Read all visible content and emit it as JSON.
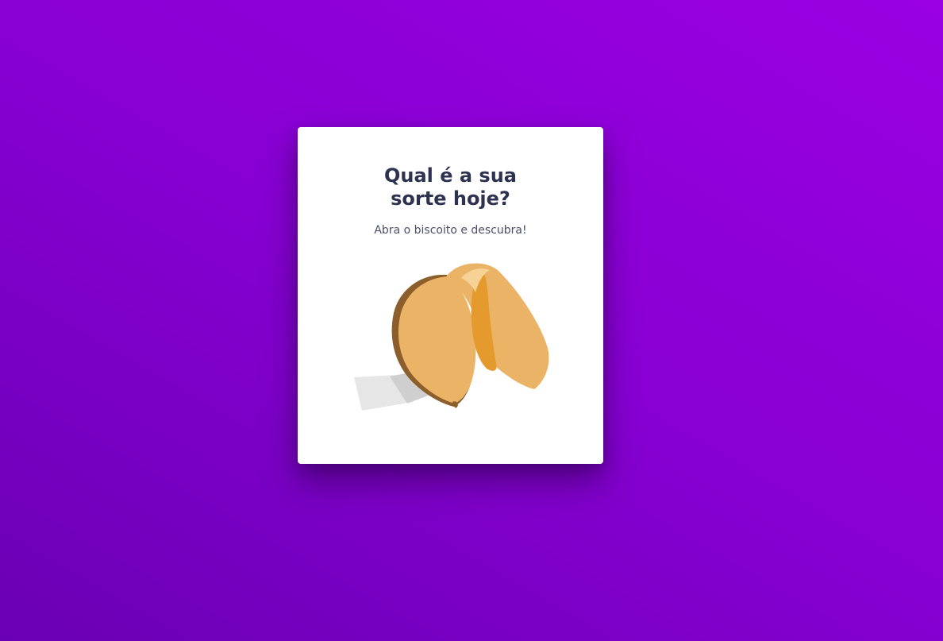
{
  "card": {
    "title": "Qual é a sua sorte hoje?",
    "subtitle": "Abra o biscoito e descubra!"
  },
  "cookie": {
    "icon": "fortune-cookie-icon"
  },
  "colors": {
    "background_start": "#6a00b4",
    "background_end": "#9a00e2",
    "card": "#ffffff",
    "title": "#2d3250",
    "subtitle": "#4a4e69",
    "cookie_body": "#ebb365",
    "cookie_inner": "#e59a2e",
    "cookie_shadow": "#8b5e2b",
    "paper": "#e6e6e6"
  }
}
